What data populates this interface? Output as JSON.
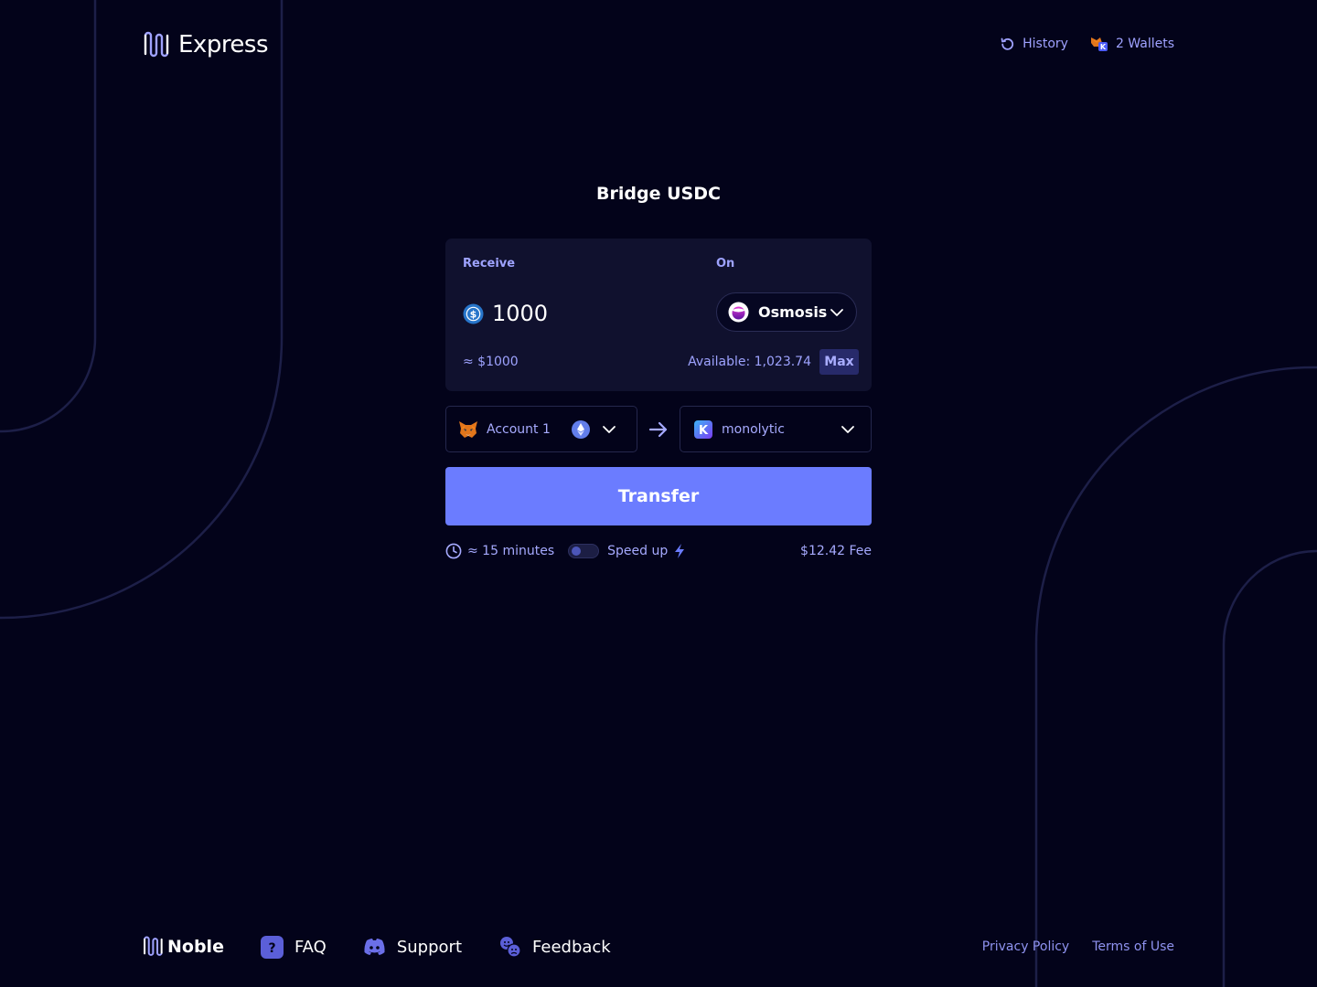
{
  "header": {
    "brand": "Express",
    "history_label": "History",
    "wallets_label": "2 Wallets"
  },
  "title": "Bridge USDC",
  "card": {
    "receive_label": "Receive",
    "on_label": "On",
    "amount": "1000",
    "chain": "Osmosis",
    "usd_value": "≈ $1000",
    "available": "Available: 1,023.74",
    "max_label": "Max"
  },
  "accounts": {
    "from": "Account 1",
    "to": "monolytic"
  },
  "transfer_label": "Transfer",
  "info": {
    "time": "≈ 15 minutes",
    "speed_up": "Speed up",
    "fee": "$12.42 Fee"
  },
  "footer": {
    "brand": "Noble",
    "faq": "FAQ",
    "support": "Support",
    "feedback": "Feedback",
    "privacy": "Privacy Policy",
    "terms": "Terms of Use"
  },
  "colors": {
    "background": "#03031a",
    "card": "#10112e",
    "accent": "#6b7cff",
    "link": "#9fa2ff"
  }
}
